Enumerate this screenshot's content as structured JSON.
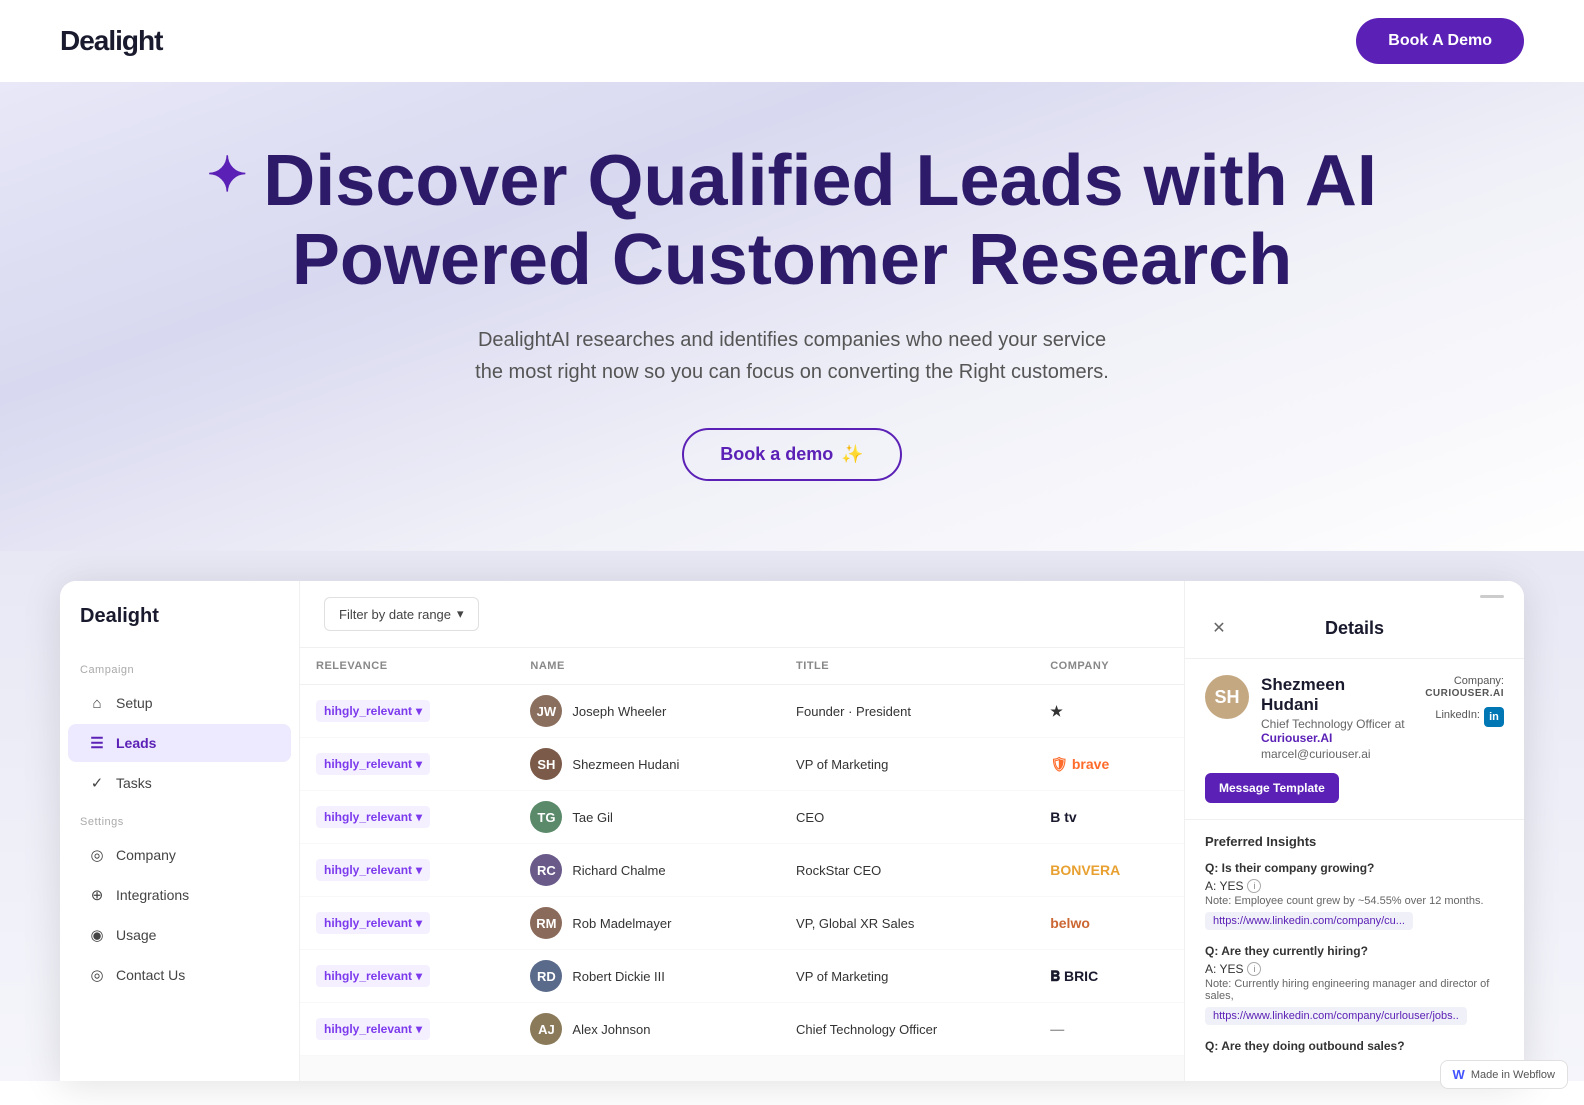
{
  "brand": {
    "name": "Dealight",
    "name_prefix": "D",
    "name_suffix": "ealight"
  },
  "navbar": {
    "book_demo_label": "Book A Demo"
  },
  "hero": {
    "icon": "✦",
    "title_line1": "Discover Qualified Leads with AI",
    "title_line2": "Powered Customer Research",
    "subtitle_line1": "DealightAI researches and identifies companies who need your service",
    "subtitle_line2": "the most right now so you can focus on converting the Right customers.",
    "cta_label": "Book a demo",
    "cta_emoji": "✨"
  },
  "sidebar": {
    "logo": "Dealight",
    "sections": [
      {
        "label": "Campaign",
        "items": [
          {
            "icon": "⌂",
            "label": "Setup",
            "active": false
          },
          {
            "icon": "☰",
            "label": "Leads",
            "active": true
          },
          {
            "icon": "✓",
            "label": "Tasks",
            "active": false
          }
        ]
      },
      {
        "label": "Settings",
        "items": [
          {
            "icon": "◎",
            "label": "Company",
            "active": false
          },
          {
            "icon": "⊕",
            "label": "Integrations",
            "active": false
          },
          {
            "icon": "◉",
            "label": "Usage",
            "active": false
          },
          {
            "icon": "◎",
            "label": "Contact Us",
            "active": false
          }
        ]
      }
    ]
  },
  "filter": {
    "label": "Filter by date range",
    "icon": "▾"
  },
  "table": {
    "columns": [
      "RELEVANCE",
      "NAME",
      "TITLE",
      "COMPANY"
    ],
    "rows": [
      {
        "relevance": "hihgly_relevant",
        "name": "Joseph Wheeler",
        "title": "Founder · President",
        "company": "★",
        "avatar_color": "#8b6f5e",
        "avatar_initials": "JW"
      },
      {
        "relevance": "hihgly_relevant",
        "name": "Shezmeen Hudani",
        "title": "VP of Marketing",
        "company": "brave",
        "avatar_color": "#7b5a4a",
        "avatar_initials": "SH"
      },
      {
        "relevance": "hihgly_relevant",
        "name": "Tae Gil",
        "title": "CEO",
        "company": "B tv",
        "avatar_color": "#5a8a6a",
        "avatar_initials": "TG"
      },
      {
        "relevance": "hihgly_relevant",
        "name": "Richard Chalme",
        "title": "RockStar CEO",
        "company": "BONVERA",
        "avatar_color": "#6a5a8a",
        "avatar_initials": "RC"
      },
      {
        "relevance": "hihgly_relevant",
        "name": "Rob Madelmayer",
        "title": "VP, Global XR Sales",
        "company": "belwo",
        "avatar_color": "#8a6a5a",
        "avatar_initials": "RM"
      },
      {
        "relevance": "hihgly_relevant",
        "name": "Robert Dickie III",
        "title": "VP of Marketing",
        "company": "B BRIC",
        "avatar_color": "#5a6a8a",
        "avatar_initials": "RD"
      },
      {
        "relevance": "hihgly_relevant",
        "name": "Alex Johnson",
        "title": "Chief Technology Officer",
        "company": "—",
        "avatar_color": "#8a7a5a",
        "avatar_initials": "AJ"
      }
    ]
  },
  "details": {
    "title": "Details",
    "close_label": "✕",
    "person": {
      "name": "Shezmeen Hudani",
      "role": "Chief Technology Officer at",
      "company_link": "Curiouser.AI",
      "email": "marcel@curiouser.ai",
      "company_label": "Company:",
      "company_value": "CURIOUSER.AI",
      "linkedin_label": "LinkedIn:",
      "linkedin_text": "in"
    },
    "message_template_label": "Message Template",
    "insights_title": "Preferred Insights",
    "insights": [
      {
        "question": "Q: Is their company growing?",
        "answer": "A: YES",
        "note": "Note: Employee count grew by ~54.55% over 12 months.",
        "link": "https://www.linkedin.com/company/cu..."
      },
      {
        "question": "Q: Are they currently hiring?",
        "answer": "A: YES",
        "note": "Note: Currently hiring engineering manager and director of sales,",
        "link": "https://www.linkedin.com/company/curlouser/jobs.."
      },
      {
        "question": "Q: Are they doing outbound sales?",
        "answer": "",
        "note": "",
        "link": ""
      }
    ]
  },
  "webflow": {
    "label": "Made in Webflow"
  }
}
